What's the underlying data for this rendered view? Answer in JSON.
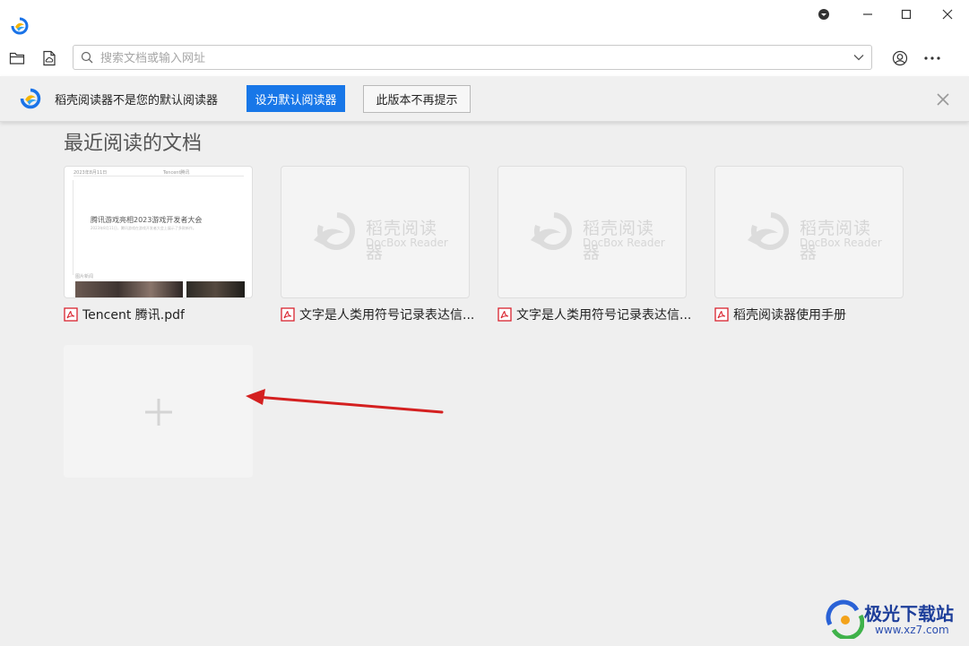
{
  "search": {
    "placeholder": "搜索文档或输入网址",
    "value": ""
  },
  "notice": {
    "message": "稻壳阅读器不是您的默认阅读器",
    "set_default_label": "设为默认阅读器",
    "dont_remind_label": "此版本不再提示"
  },
  "recent": {
    "title": "最近阅读的文档",
    "items": [
      {
        "name": "Tencent 腾讯.pdf"
      },
      {
        "name": "文字是人类用符号记录表达信..."
      },
      {
        "name": "文字是人类用符号记录表达信..."
      },
      {
        "name": "稻壳阅读器使用手册"
      }
    ]
  },
  "thumbnail_watermark": {
    "cn": "稻壳阅读器",
    "en": "DocBox Reader"
  },
  "preview_doc": {
    "header_left": "2023年8月11日",
    "header_right": "Tencent腾讯",
    "title": "腾讯游戏亮相2023游戏开发者大会",
    "subtitle": "2023年8月11日，腾讯游戏在游戏开发者大会上展示了多款新作。",
    "section": "图片新闻"
  },
  "site_watermark": {
    "cn": "极光下载站",
    "en": "www.xz7.com"
  },
  "colors": {
    "accent": "#1877e8",
    "pdf_icon": "#d9232e",
    "arrow": "#d42020"
  }
}
